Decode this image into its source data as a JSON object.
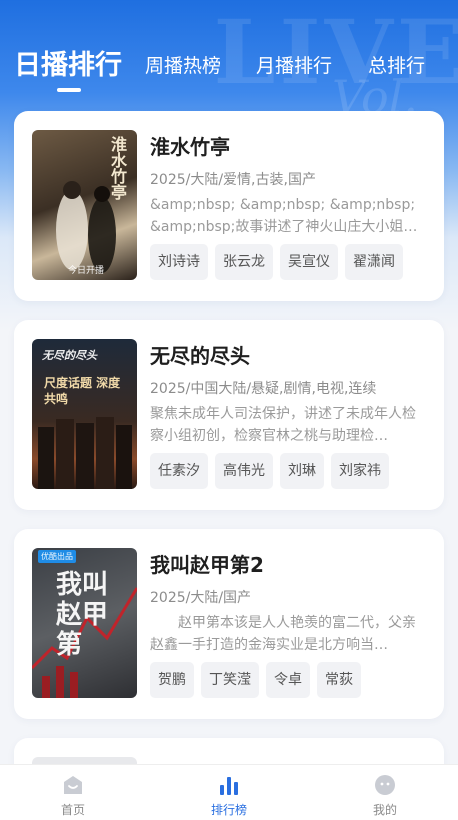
{
  "tabs": [
    {
      "label": "日播排行",
      "active": true
    },
    {
      "label": "周播热榜",
      "active": false
    },
    {
      "label": "月播排行",
      "active": false
    },
    {
      "label": "总排行",
      "active": false
    }
  ],
  "items": [
    {
      "title": "淮水竹亭",
      "meta": "2025/大陆/爱情,古装,国产",
      "desc": "&amp;nbsp; &amp;nbsp; &amp;nbsp; &amp;nbsp;故事讲述了神火山庄大小姐…",
      "actors": [
        "刘诗诗",
        "张云龙",
        "吴宣仪",
        "翟潇闻"
      ],
      "poster_text": "淮水竹亭",
      "poster_badge": "今日开播"
    },
    {
      "title": "无尽的尽头",
      "meta": "2025/中国大陆/悬疑,剧情,电视,连续",
      "desc": "聚焦未成年人司法保护，讲述了未成年人检察小组初创，检察官林之桃与助理检…",
      "actors": [
        "任素汐",
        "高伟光",
        "刘琳",
        "刘家祎"
      ],
      "poster_text": "无尽的尽头",
      "poster_sub": "尺度话题 深度共鸣"
    },
    {
      "title": "我叫赵甲第2",
      "meta": "2025/大陆/国产",
      "desc": "　　赵甲第本该是人人艳羡的富二代，父亲赵鑫一手打造的金海实业是北方响当…",
      "actors": [
        "贺鹏",
        "丁笑滢",
        "令卓",
        "常荻"
      ],
      "poster_text": "我叫赵甲第",
      "poster_badge": "优酷出品"
    }
  ],
  "tabbar": [
    {
      "label": "首页",
      "icon": "home-icon",
      "active": false
    },
    {
      "label": "排行榜",
      "icon": "ranking-icon",
      "active": true
    },
    {
      "label": "我的",
      "icon": "profile-icon",
      "active": false
    }
  ],
  "colors": {
    "accent": "#1f6fe0",
    "active_tab_text": "#2a6fe0",
    "inactive_tab_text": "#8a8a8a"
  }
}
